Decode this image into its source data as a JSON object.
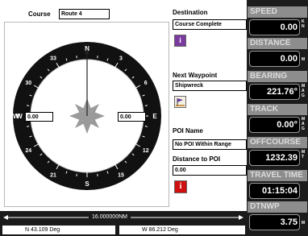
{
  "course": {
    "label": "Course",
    "value": "Route 4"
  },
  "destination": {
    "label": "Destination",
    "value": "Course Complete"
  },
  "next_waypoint": {
    "label": "Next Waypoint",
    "value": "Shipwreck"
  },
  "poi": {
    "name_label": "POI Name",
    "name_value": "No POI Within Range",
    "distance_label": "Distance to POI",
    "distance_value": "0.00"
  },
  "compass": {
    "left_field": "0.00",
    "right_field": "0.00",
    "marks": [
      {
        "deg": 0,
        "text": "N"
      },
      {
        "deg": 30,
        "text": "3"
      },
      {
        "deg": 60,
        "text": "6"
      },
      {
        "deg": 90,
        "text": "E"
      },
      {
        "deg": 120,
        "text": "12"
      },
      {
        "deg": 150,
        "text": "15"
      },
      {
        "deg": 180,
        "text": "S"
      },
      {
        "deg": 210,
        "text": "21"
      },
      {
        "deg": 240,
        "text": "24"
      },
      {
        "deg": 270,
        "text": "W"
      },
      {
        "deg": 300,
        "text": "30"
      },
      {
        "deg": 330,
        "text": "33"
      }
    ]
  },
  "gauges": {
    "speed": {
      "label": "SPEED",
      "value": "0.00",
      "unit": "K\nN"
    },
    "distance": {
      "label": "DISTANCE",
      "value": "0.00",
      "unit": "M"
    },
    "bearing": {
      "label": "BEARING",
      "value": "221.76°",
      "unit": "M\nA\nG"
    },
    "track": {
      "label": "TRACK",
      "value": "0.00°",
      "unit": "M\nA\nG"
    },
    "offcourse": {
      "label": "OFFCOURSE",
      "value": "1232.39",
      "unit": "M\nT"
    },
    "traveltime": {
      "label": "TRAVEL TIME",
      "value": "01:15:04",
      "unit": ""
    },
    "dtnwp": {
      "label": "DTNWP",
      "value": "3.75",
      "unit": "M"
    }
  },
  "scale": {
    "value": "16.000000NM"
  },
  "position": {
    "lat": "N 43.109 Deg",
    "lon": "W 86.212 Deg"
  },
  "colors": {
    "alert_red": "#d01010",
    "info_purple": "#7a3aa0",
    "compass_dark": "#111111",
    "rose_grey": "#9a9a9a"
  }
}
